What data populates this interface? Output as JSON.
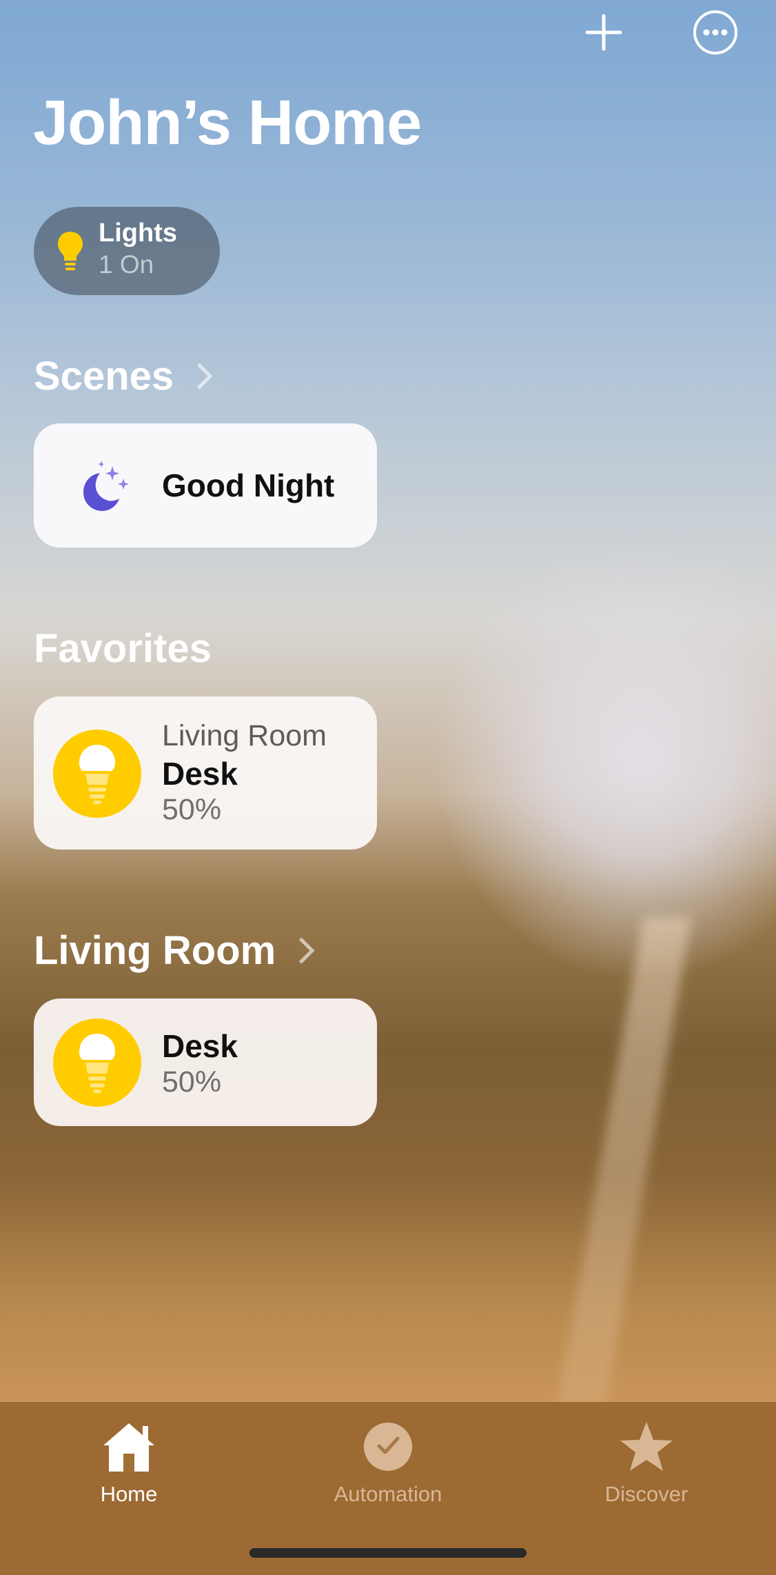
{
  "header": {
    "title": "John’s Home",
    "add_icon": "plus-icon",
    "more_icon": "ellipsis-circle-icon"
  },
  "status_pill": {
    "icon": "lightbulb-icon",
    "label": "Lights",
    "status": "1 On"
  },
  "scenes": {
    "heading": "Scenes",
    "items": [
      {
        "name": "Good Night",
        "icon": "moon-stars-icon",
        "icon_color": "#5b4fd3"
      }
    ]
  },
  "favorites": {
    "heading": "Favorites",
    "items": [
      {
        "room": "Living Room",
        "name": "Desk",
        "value": "50%",
        "icon": "lightbulb-icon",
        "icon_color": "#ffcc00"
      }
    ]
  },
  "living_room": {
    "heading": "Living Room",
    "items": [
      {
        "name": "Desk",
        "value": "50%",
        "icon": "lightbulb-icon",
        "icon_color": "#ffcc00"
      }
    ]
  },
  "tabbar": {
    "tabs": [
      {
        "label": "Home",
        "icon": "house-icon",
        "selected": true
      },
      {
        "label": "Automation",
        "icon": "clock-check-icon",
        "selected": false
      },
      {
        "label": "Discover",
        "icon": "star-icon",
        "selected": false
      }
    ]
  }
}
